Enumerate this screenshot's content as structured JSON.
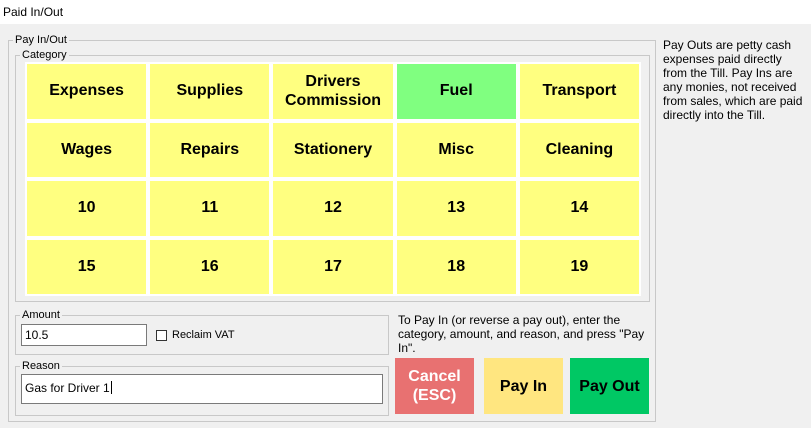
{
  "window": {
    "title": "Paid In/Out"
  },
  "groups": {
    "pay_in_out": "Pay In/Out",
    "category": "Category",
    "amount": "Amount",
    "reason": "Reason"
  },
  "categories": [
    "Expenses",
    "Supplies",
    "Drivers Commission",
    "Fuel",
    "Transport",
    "Wages",
    "Repairs",
    "Stationery",
    "Misc",
    "Cleaning",
    "10",
    "11",
    "12",
    "13",
    "14",
    "15",
    "16",
    "17",
    "18",
    "19"
  ],
  "selected_category": "Fuel",
  "colors": {
    "category": "#ffff80",
    "category_selected": "#80ff80",
    "cancel": "#e87171",
    "pay_in": "#ffe680",
    "pay_out": "#00c864"
  },
  "info_text": "Pay Outs are petty cash expenses paid directly from the Till. Pay Ins are any monies, not received from sales, which are paid directly into the Till.",
  "amount_value": "10.5",
  "reclaim_vat_label": "Reclaim VAT",
  "reclaim_vat_checked": false,
  "reason_value": "Gas for Driver 1",
  "pay_in_hint": "To Pay In (or reverse a pay out), enter the category, amount, and reason, and press \"Pay In\".",
  "buttons": {
    "cancel": "Cancel (ESC)",
    "pay_in": "Pay In",
    "pay_out": "Pay Out"
  }
}
